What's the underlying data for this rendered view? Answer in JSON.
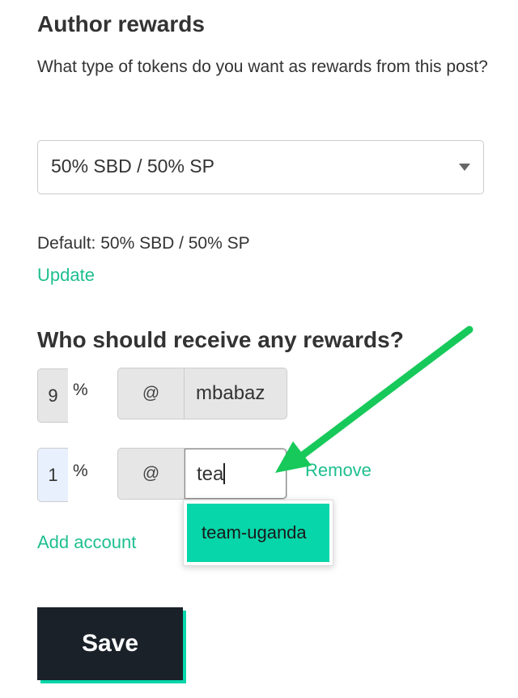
{
  "author_rewards": {
    "title": "Author rewards",
    "question": "What type of tokens do you want as rewards from this post?",
    "selected_option": "50% SBD / 50% SP",
    "default_text": "Default: 50% SBD / 50% SP",
    "update_label": "Update"
  },
  "beneficiaries": {
    "title": "Who should receive any rewards?",
    "rows": [
      {
        "percent": "9",
        "percent_sign": "%",
        "at": "@",
        "account": "mbabaz"
      },
      {
        "percent": "1",
        "percent_sign": "%",
        "at": "@",
        "account": "tea",
        "remove_label": "Remove"
      }
    ],
    "suggestion": "team-uganda",
    "add_account_label": "Add account"
  },
  "save_label": "Save",
  "colors": {
    "accent": "#06d6a9",
    "link": "#1fbf8f",
    "annotation_arrow": "#17c95a",
    "button": "#1a2129"
  }
}
